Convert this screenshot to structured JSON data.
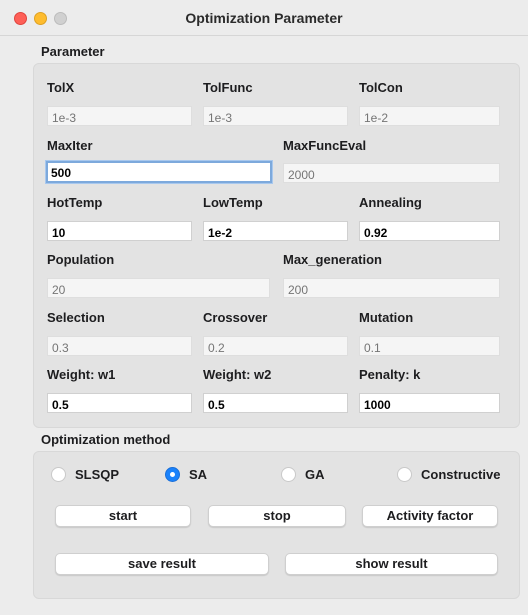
{
  "window": {
    "title": "Optimization Parameter"
  },
  "parameter_group": {
    "title": "Parameter",
    "fields": {
      "tolx": {
        "label": "TolX",
        "value": "",
        "placeholder": "1e-3"
      },
      "tolfunc": {
        "label": "TolFunc",
        "value": "",
        "placeholder": "1e-3"
      },
      "tolcon": {
        "label": "TolCon",
        "value": "",
        "placeholder": "1e-2"
      },
      "maxiter": {
        "label": "MaxIter",
        "value": "500",
        "placeholder": ""
      },
      "maxfunceval": {
        "label": "MaxFuncEval",
        "value": "",
        "placeholder": "2000"
      },
      "hottemp": {
        "label": "HotTemp",
        "value": "10",
        "placeholder": ""
      },
      "lowtemp": {
        "label": "LowTemp",
        "value": "1e-2",
        "placeholder": ""
      },
      "annealing": {
        "label": "Annealing",
        "value": "0.92",
        "placeholder": ""
      },
      "population": {
        "label": "Population",
        "value": "",
        "placeholder": "20"
      },
      "max_generation": {
        "label": "Max_generation",
        "value": "",
        "placeholder": "200"
      },
      "selection": {
        "label": "Selection",
        "value": "",
        "placeholder": "0.3"
      },
      "crossover": {
        "label": "Crossover",
        "value": "",
        "placeholder": "0.2"
      },
      "mutation": {
        "label": "Mutation",
        "value": "",
        "placeholder": "0.1"
      },
      "weight_w1": {
        "label": "Weight: w1",
        "value": "0.5",
        "placeholder": ""
      },
      "weight_w2": {
        "label": "Weight: w2",
        "value": "0.5",
        "placeholder": ""
      },
      "penalty_k": {
        "label": "Penalty: k",
        "value": "1000",
        "placeholder": ""
      }
    }
  },
  "method_group": {
    "title": "Optimization method",
    "options": {
      "slsqp": {
        "label": "SLSQP",
        "selected": false
      },
      "sa": {
        "label": "SA",
        "selected": true
      },
      "ga": {
        "label": "GA",
        "selected": false
      },
      "constructive": {
        "label": "Constructive",
        "selected": false
      }
    },
    "buttons": {
      "start": "start",
      "stop": "stop",
      "activity_factor": "Activity factor",
      "save_result": "save result",
      "show_result": "show result"
    }
  },
  "colors": {
    "accent": "#1a82fb",
    "focus_ring": "#7da9dc",
    "close": "#fe5f57",
    "minimize": "#febc2e"
  }
}
